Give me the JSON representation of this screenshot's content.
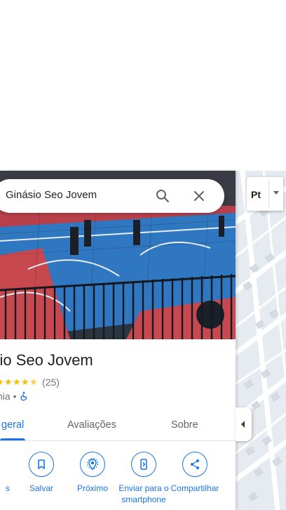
{
  "search": {
    "query": "Ginásio Seo Jovem"
  },
  "place": {
    "title": "Ginásio Seo Jovem",
    "rating_count": "(25)",
    "rating": 4.5,
    "category": "nia •"
  },
  "tabs": [
    {
      "label": "geral",
      "active": true
    },
    {
      "label": "Avaliações",
      "active": false
    },
    {
      "label": "Sobre",
      "active": false
    }
  ],
  "actions": [
    {
      "label": "s",
      "icon": "directions-icon"
    },
    {
      "label": "Salvar",
      "icon": "bookmark-icon"
    },
    {
      "label": "Próximo",
      "icon": "nearby-icon"
    },
    {
      "label": "Enviar para o smartphone",
      "icon": "send-to-phone-icon"
    },
    {
      "label": "Compartilhar",
      "icon": "share-icon"
    }
  ],
  "map_controls": {
    "layer_label": "Pt"
  },
  "colors": {
    "accent": "#1a73e8",
    "star": "#fbbc04"
  }
}
